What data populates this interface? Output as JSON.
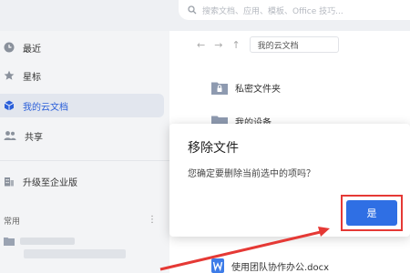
{
  "search": {
    "placeholder": "搜索文档、应用、模板、Office 技巧..."
  },
  "sidebar": {
    "items": [
      {
        "label": "最近",
        "icon": "clock-icon"
      },
      {
        "label": "星标",
        "icon": "star-icon"
      },
      {
        "label": "我的云文档",
        "icon": "cube-icon",
        "active": true
      },
      {
        "label": "共享",
        "icon": "people-icon"
      },
      {
        "label": "升级至企业版",
        "icon": "building-icon"
      }
    ],
    "section_label": "常用",
    "menu_glyph": "⋮"
  },
  "main": {
    "breadcrumb": "我的云文档",
    "files": [
      {
        "name": "私密文件夹",
        "type": "folder-lock"
      },
      {
        "name": "我的设备",
        "type": "folder"
      }
    ],
    "doc_name": "使用团队协作办公.docx"
  },
  "dialog": {
    "title": "移除文件",
    "message": "您确定要删除当前选中的项吗？",
    "confirm_label": "是"
  },
  "colors": {
    "accent": "#2f6fe4",
    "highlight": "#e53935",
    "active_nav_bg": "#e2e6ee"
  }
}
